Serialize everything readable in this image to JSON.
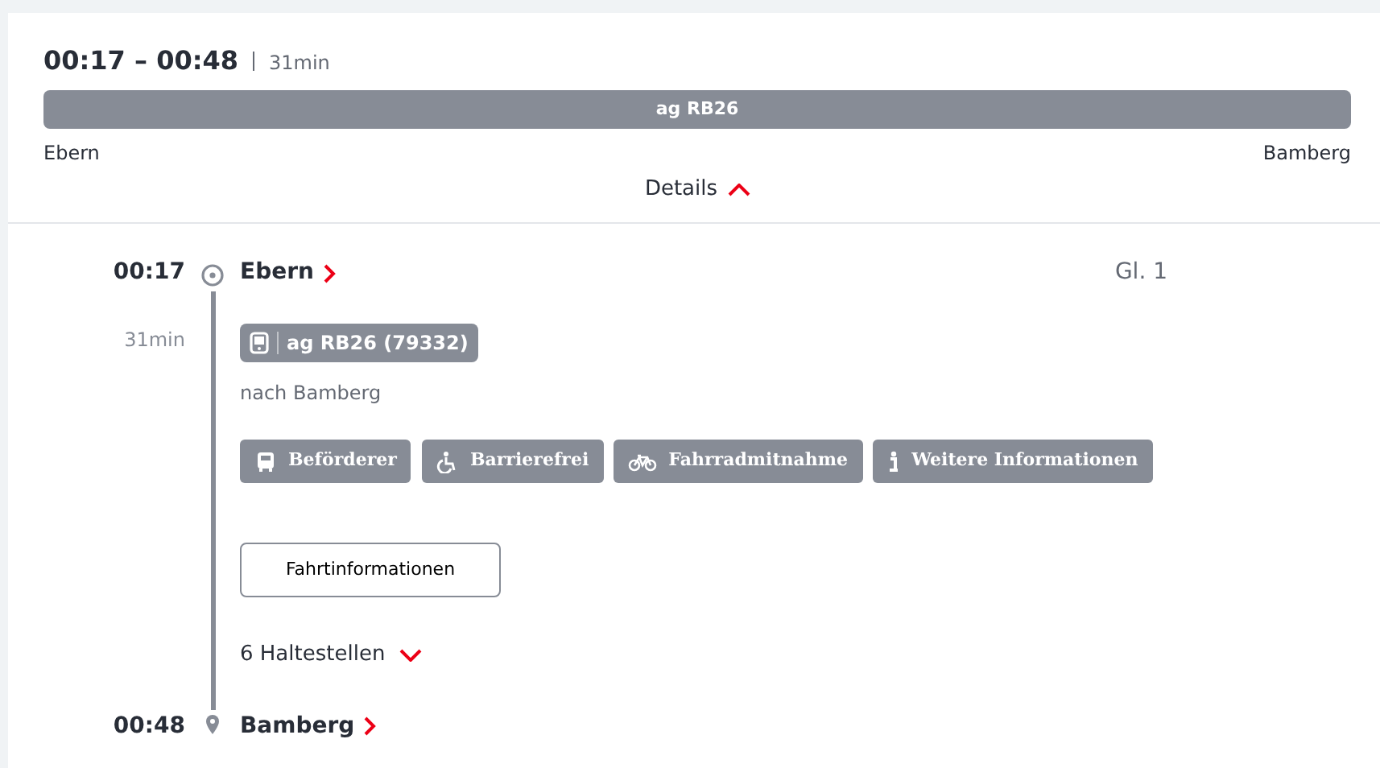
{
  "summary": {
    "time_range": "00:17 – 00:48",
    "duration": "31min",
    "train_label": "ag RB26",
    "from": "Ebern",
    "to": "Bamberg",
    "details_label": "Details",
    "details_expanded": true
  },
  "journey": {
    "departure": {
      "time": "00:17",
      "station": "Ebern",
      "platform": "Gl. 1"
    },
    "duration": "31min",
    "train": {
      "label": "ag RB26 (79332)"
    },
    "direction": "nach Bamberg",
    "attributes": [
      {
        "kind": "bus",
        "label": "Beförderer"
      },
      {
        "kind": "wheelchair",
        "label": "Barrierefrei"
      },
      {
        "kind": "bicycle",
        "label": "Fahrradmitnahme"
      },
      {
        "kind": "info",
        "label": "Weitere Informationen"
      }
    ],
    "info_button": "Fahrtinformationen",
    "stops": {
      "label": "6 Haltestellen",
      "expanded": false
    },
    "arrival": {
      "time": "00:48",
      "station": "Bamberg"
    }
  }
}
